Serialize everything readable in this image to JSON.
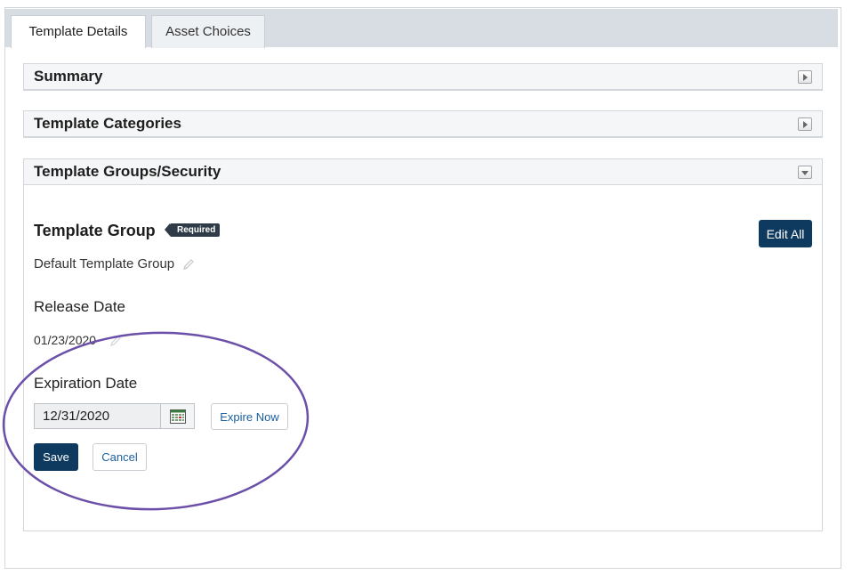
{
  "tabs": [
    {
      "label": "Template Details",
      "active": true
    },
    {
      "label": "Asset Choices",
      "active": false
    }
  ],
  "panels": {
    "summary": {
      "title": "Summary",
      "state": "collapsed"
    },
    "categories": {
      "title": "Template Categories",
      "state": "collapsed"
    },
    "groups_security": {
      "title": "Template Groups/Security",
      "state": "expanded"
    }
  },
  "template_group": {
    "heading": "Template Group",
    "badge": "Required",
    "value": "Default Template Group",
    "edit_all_label": "Edit All"
  },
  "release_date": {
    "label": "Release Date",
    "value": "01/23/2020"
  },
  "expiration_date": {
    "label": "Expiration Date",
    "value": "12/31/2020",
    "expire_now_label": "Expire Now"
  },
  "actions": {
    "save_label": "Save",
    "cancel_label": "Cancel"
  },
  "colors": {
    "primary_button": "#0e3a5f",
    "link": "#1a5f9e",
    "annotation_ellipse": "#6b4fa8"
  },
  "icons": [
    "expand-arrow-icon",
    "collapse-arrow-icon",
    "pencil-icon",
    "calendar-icon"
  ]
}
